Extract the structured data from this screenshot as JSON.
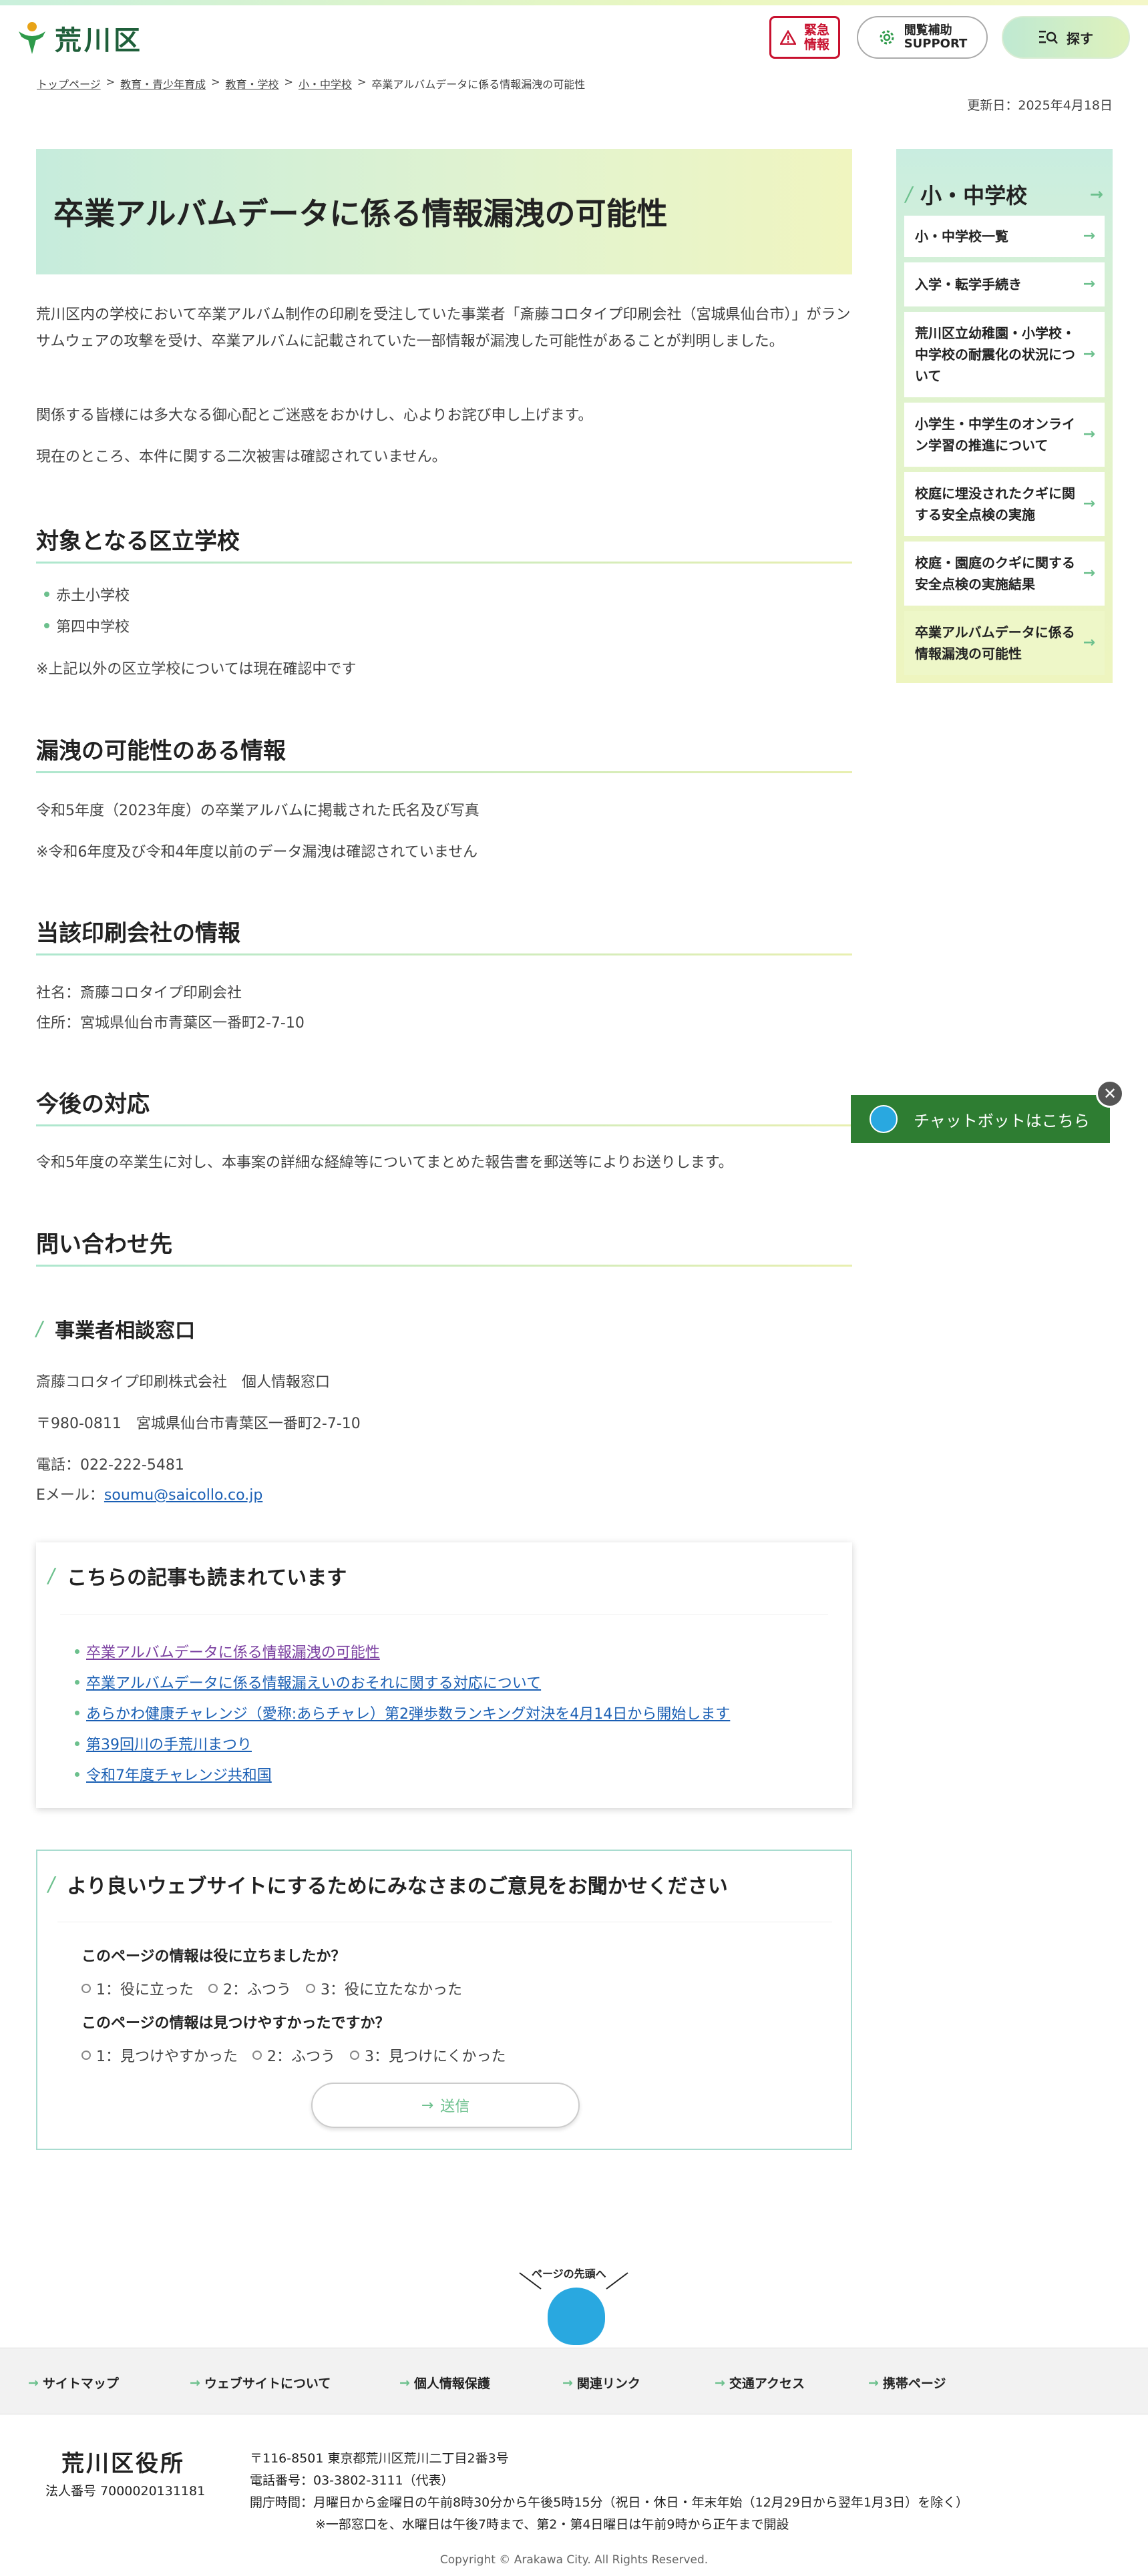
{
  "header": {
    "logo_text": "荒川区",
    "emergency": "緊急\n情報",
    "emergency_line1": "緊急",
    "emergency_line2": "情報",
    "support_line1": "閲覧補助",
    "support_line2": "SUPPORT",
    "search": "探す"
  },
  "breadcrumb": [
    "トップページ",
    "教育・青少年育成",
    "教育・学校",
    "小・中学校",
    "卒業アルバムデータに係る情報漏洩の可能性"
  ],
  "updated": "更新日：2025年4月18日",
  "page_title": "卒業アルバムデータに係る情報漏洩の可能性",
  "intro": {
    "p1": "荒川区内の学校において卒業アルバム制作の印刷を受注していた事業者「斎藤コロタイプ印刷会社（宮城県仙台市）」がランサムウェアの攻撃を受け、卒業アルバムに記載されていた一部情報が漏洩した可能性があることが判明しました。",
    "p2": "関係する皆様には多大なる御心配とご迷惑をおかけし、心よりお詫び申し上げます。",
    "p3": "現在のところ、本件に関する二次被害は確認されていません。"
  },
  "schools": {
    "heading": "対象となる区立学校",
    "items": [
      "赤土小学校",
      "第四中学校"
    ],
    "note": "※上記以外の区立学校については現在確認中です"
  },
  "leak": {
    "heading": "漏洩の可能性のある情報",
    "p1": "令和5年度（2023年度）の卒業アルバムに掲載された氏名及び写真",
    "p2": "※令和6年度及び令和4年度以前のデータ漏洩は確認されていません"
  },
  "company": {
    "heading": "当該印刷会社の情報",
    "name": "社名：斎藤コロタイプ印刷会社",
    "address": "住所：宮城県仙台市青葉区一番町2-7-10"
  },
  "future": {
    "heading": "今後の対応",
    "p1": "令和5年度の卒業生に対し、本事案の詳細な経緯等についてまとめた報告書を郵送等によりお送りします。"
  },
  "contact": {
    "heading": "問い合わせ先",
    "subheading": "事業者相談窓口",
    "org": "斎藤コロタイプ印刷株式会社　個人情報窓口",
    "postal": "〒980-0811　宮城県仙台市青葉区一番町2-7-10",
    "phone": "電話：022-222-5481",
    "email_label": "Eメール：",
    "email": "soumu@saicollo.co.jp"
  },
  "related": {
    "heading": "こちらの記事も読まれています",
    "links": [
      "卒業アルバムデータに係る情報漏洩の可能性",
      "卒業アルバムデータに係る情報漏えいのおそれに関する対応について",
      "あらかわ健康チャレンジ（愛称:あらチャレ）第2弾歩数ランキング対決を4月14日から開始します",
      "第39回川の手荒川まつり",
      "令和7年度チャレンジ共和国"
    ]
  },
  "survey": {
    "heading": "より良いウェブサイトにするためにみなさまのご意見をお聞かせください",
    "q1": "このページの情報は役に立ちましたか？",
    "q1_options": [
      "1：役に立った",
      "2：ふつう",
      "3：役に立たなかった"
    ],
    "q2": "このページの情報は見つけやすかったですか？",
    "q2_options": [
      "1：見つけやすかった",
      "2：ふつう",
      "3：見つけにくかった"
    ],
    "submit": "送信"
  },
  "side_nav": {
    "title": "小・中学校",
    "items": [
      "小・中学校一覧",
      "入学・転学手続き",
      "荒川区立幼稚園・小学校・中学校の耐震化の状況について",
      "小学生・中学生のオンライン学習の推進について",
      "校庭に埋没されたクギに関する安全点検の実施",
      "校庭・園庭のクギに関する安全点検の実施結果",
      "卒業アルバムデータに係る情報漏洩の可能性"
    ]
  },
  "chatbot": {
    "label": "チャットボットはこちら"
  },
  "pagetop": {
    "label": "ページの先頭へ"
  },
  "footer_nav": [
    "サイトマップ",
    "ウェブサイトについて",
    "個人情報保護",
    "関連リンク",
    "交通アクセス",
    "携帯ページ"
  ],
  "footer": {
    "org": "荒川区役所",
    "corp_no": "法人番号 7000020131181",
    "address": "〒116-8501 東京都荒川区荒川二丁目2番3号",
    "phone": "電話番号：03-3802-3111（代表）",
    "hours": "開庁時間：月曜日から金曜日の午前8時30分から午後5時15分（祝日・休日・年末年始（12月29日から翌年1月3日）を除く）",
    "note": "※一部窓口を、水曜日は午後7時まで、第2・第4日曜日は午前9時から正午まで開設",
    "copyright": "Copyright © Arakawa City. All Rights Reserved."
  },
  "colors": {
    "accent_green": "#6cc08d",
    "emergency_red": "#c8102e",
    "chatbot_green": "#2e7d32",
    "link_blue": "#1a5fb4"
  }
}
